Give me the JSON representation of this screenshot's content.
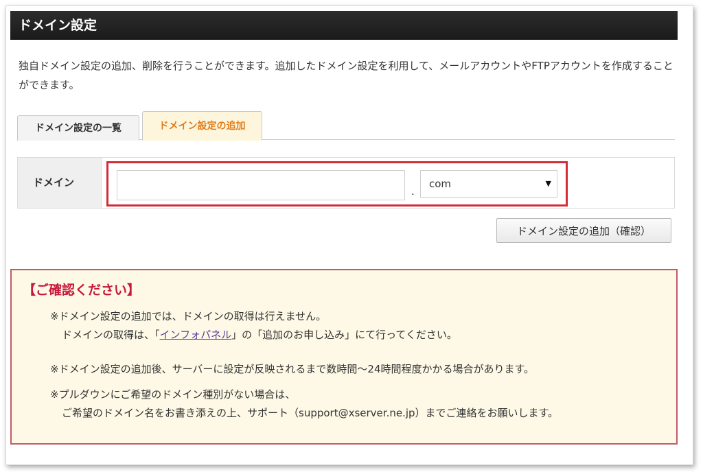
{
  "header": {
    "title": "ドメイン設定"
  },
  "description": "独自ドメイン設定の追加、削除を行うことができます。追加したドメイン設定を利用して、メールアカウントやFTPアカウントを作成することができます。",
  "tabs": [
    {
      "label": "ドメイン設定の一覧",
      "active": false
    },
    {
      "label": "ドメイン設定の追加",
      "active": true
    }
  ],
  "form": {
    "label": "ドメイン",
    "domain_value": "",
    "separator": ".",
    "tld_selected": "com",
    "submit_label": "ドメイン設定の追加（確認）"
  },
  "notice": {
    "title": "【ご確認ください】",
    "item1_line1": "※ドメイン設定の追加では、ドメインの取得は行えません。",
    "item1_line2_pre": "ドメインの取得は、「",
    "item1_link": "インフォパネル",
    "item1_line2_post": "」の「追加のお申し込み」にて行ってください。",
    "item2": "※ドメイン設定の追加後、サーバーに設定が反映されるまで数時間～24時間程度かかる場合があります。",
    "item3_line1": "※プルダウンにご希望のドメイン種別がない場合は、",
    "item3_line2": "ご希望のドメイン名をお書き添えの上、サポート（support@xserver.ne.jp）までご連絡をお願いします。"
  },
  "colors": {
    "title_bar": "#1f1f1f",
    "active_tab_text": "#e07c1a",
    "highlight": "#d42b36",
    "notice_title": "#c8183a",
    "notice_bg": "#fdf9e6",
    "link": "#5b3e9a"
  }
}
